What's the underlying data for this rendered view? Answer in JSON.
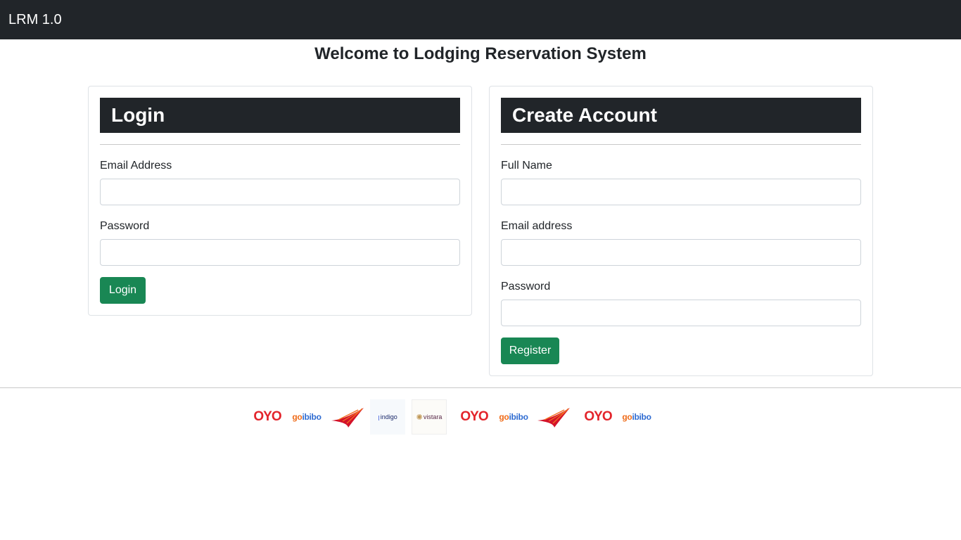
{
  "navbar": {
    "brand": "LRM 1.0"
  },
  "page": {
    "welcome": "Welcome to Lodging Reservation System"
  },
  "login": {
    "title": "Login",
    "email_label": "Email Address",
    "email_value": "",
    "password_label": "Password",
    "password_value": "",
    "submit_label": "Login"
  },
  "register": {
    "title": "Create Account",
    "name_label": "Full Name",
    "name_value": "",
    "email_label": "Email address",
    "email_value": "",
    "password_label": "Password",
    "password_value": "",
    "submit_label": "Register"
  },
  "partners": {
    "oyo": "OYO",
    "goibibo_go": "go",
    "goibibo_ibibo": "ibibo",
    "indigo": "indigo",
    "vistara": "vistara"
  },
  "colors": {
    "navbar_bg": "#212529",
    "card_head_bg": "#212529",
    "button_bg": "#198754",
    "oyo_red": "#e3242b",
    "air_india_red": "#d3122a",
    "air_india_orange": "#f37021"
  },
  "icons": [
    "oyo-logo",
    "goibibo-logo",
    "air-india-logo",
    "indigo-logo",
    "vistara-logo"
  ]
}
